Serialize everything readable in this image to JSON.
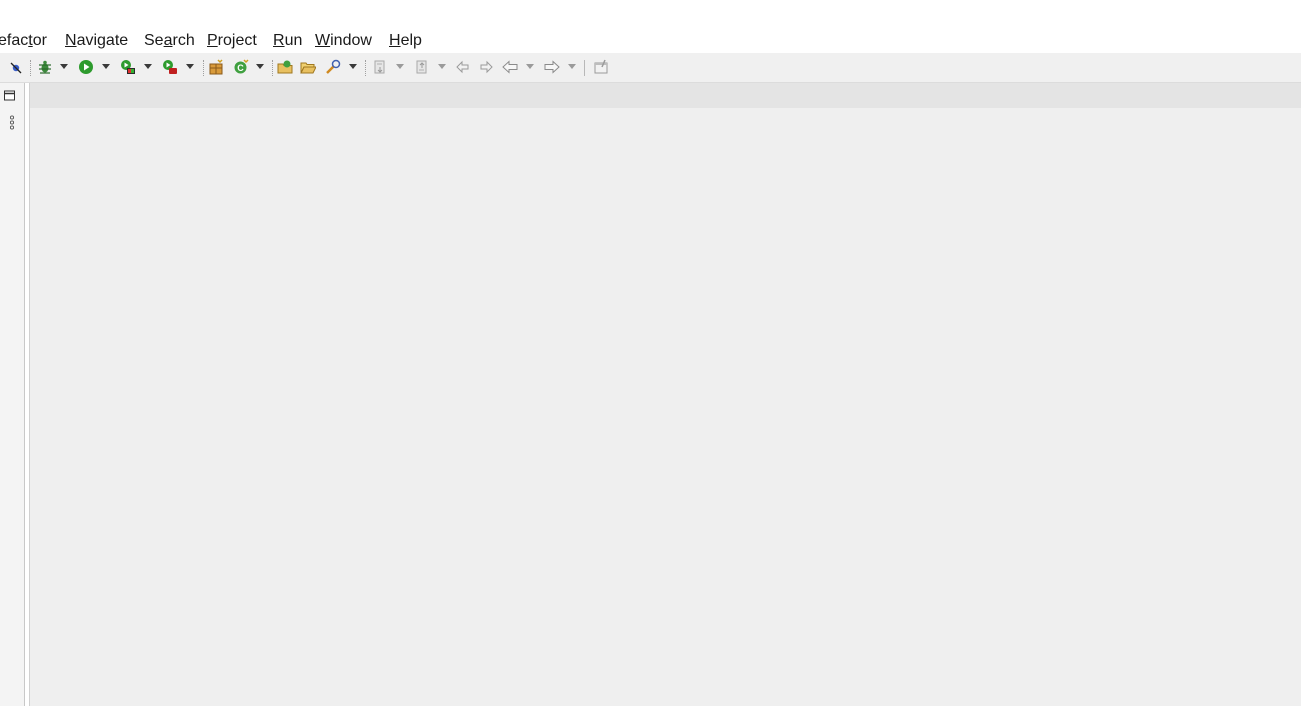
{
  "menubar": {
    "items": [
      {
        "label": "efactor"
      },
      {
        "label": "Navigate"
      },
      {
        "label": "Search"
      },
      {
        "label": "Project"
      },
      {
        "label": "Run"
      },
      {
        "label": "Window"
      },
      {
        "label": "Help"
      }
    ]
  },
  "toolbar": {
    "icons": [
      "skip-breakpoints-icon",
      "debug-icon",
      "run-icon",
      "coverage-icon",
      "external-tools-icon",
      "new-package-icon",
      "new-class-icon",
      "open-type-icon",
      "open-folder-icon",
      "search-icon",
      "next-annotation-icon",
      "previous-annotation-icon",
      "last-edit-icon",
      "back-icon",
      "forward-icon",
      "pin-editor-icon"
    ]
  },
  "colors": {
    "toolbar_bg": "#f0f0f0",
    "editor_bg": "#efefef",
    "editor_header_bg": "#e4e4e4",
    "run_green": "#2e9b2e",
    "debug_green": "#3c8a3c"
  }
}
